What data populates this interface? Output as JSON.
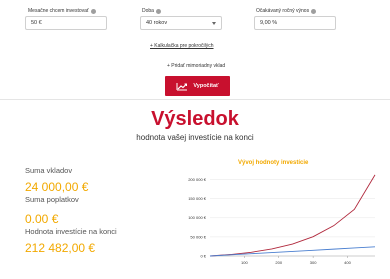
{
  "form": {
    "monthly_investment": {
      "label": "Mesačne chcem investovať",
      "value": "50 €",
      "info_icon": "info-icon"
    },
    "duration": {
      "label": "Doba",
      "value": "40 rokov",
      "info_icon": "info-icon"
    },
    "expected_return": {
      "label": "Očakávaný ročný výnos",
      "value": "9,00 %",
      "info_icon": "info-icon"
    }
  },
  "links": {
    "advanced_calculator": "+ Kalkulačka pre pokročilých",
    "extraordinary_deposit": "+ Pridať mimoriadny vklad"
  },
  "calculate_button": {
    "label": "Vypočítať",
    "icon": "chart-trend-icon"
  },
  "result": {
    "title": "Výsledok",
    "subtitle": "hodnota vašej investície na konci"
  },
  "stats": [
    {
      "label": "Suma vkladov",
      "value": "24 000,00 €"
    },
    {
      "label": "Suma poplatkov",
      "value": "0.00 €"
    },
    {
      "label": "Hodnota investície na konci",
      "value": "212 482,00 €"
    }
  ],
  "colors": {
    "accent_red": "#c8102e",
    "accent_gold": "#f2a900",
    "series_value": "#b0283c",
    "series_deposits": "#4a7fd0"
  },
  "chart_data": {
    "type": "line",
    "title": "Vývoj hodnoty investície",
    "x_ticks": [
      "100",
      "200",
      "300",
      "400"
    ],
    "y_ticks": [
      "0 €",
      "50 000 €",
      "100 000 €",
      "150 000 €",
      "200 000 €"
    ],
    "xlim": [
      0,
      480
    ],
    "ylim": [
      0,
      220000
    ],
    "series": [
      {
        "key": "value",
        "x": [
          0,
          60,
          120,
          180,
          240,
          300,
          360,
          420,
          480
        ],
        "values": [
          0,
          3900,
          9700,
          18400,
          31300,
          50600,
          79400,
          122200,
          212482
        ]
      },
      {
        "key": "deposits",
        "x": [
          0,
          60,
          120,
          180,
          240,
          300,
          360,
          420,
          480
        ],
        "values": [
          0,
          3000,
          6000,
          9000,
          12000,
          15000,
          18000,
          21000,
          24000
        ]
      }
    ]
  }
}
